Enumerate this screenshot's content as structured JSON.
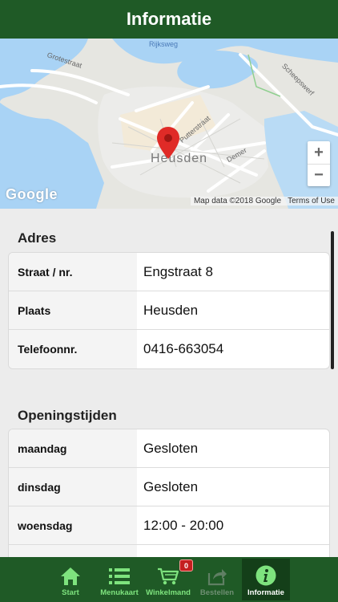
{
  "header": {
    "title": "Informatie"
  },
  "map": {
    "town_label": "Heusden",
    "street_labels": [
      "Grotestraat",
      "Putterstraat",
      "Demer",
      "Scheepswerf",
      "Rijksweg"
    ],
    "google_logo": "Google",
    "attribution": "Map data ©2018 Google",
    "terms": "Terms of Use",
    "zoom_in": "+",
    "zoom_out": "−"
  },
  "address": {
    "title": "Adres",
    "rows": [
      {
        "label": "Straat / nr.",
        "value": "Engstraat 8"
      },
      {
        "label": "Plaats",
        "value": "Heusden"
      },
      {
        "label": "Telefoonnr.",
        "value": "0416-663054"
      }
    ]
  },
  "hours": {
    "title": "Openingstijden",
    "rows": [
      {
        "label": "maandag",
        "value": "Gesloten"
      },
      {
        "label": "dinsdag",
        "value": "Gesloten"
      },
      {
        "label": "woensdag",
        "value": "12:00 - 20:00"
      }
    ]
  },
  "tabbar": {
    "tabs": [
      {
        "label": "Start",
        "icon": "home-icon"
      },
      {
        "label": "Menukaart",
        "icon": "list-icon"
      },
      {
        "label": "Winkelmand",
        "icon": "cart-icon",
        "badge": "0"
      },
      {
        "label": "Bestellen",
        "icon": "share-icon",
        "disabled": true
      },
      {
        "label": "Informatie",
        "icon": "info-icon",
        "active": true
      }
    ]
  },
  "colors": {
    "brand_green": "#1f5a26",
    "tab_text": "#7ee37e",
    "badge_red": "#c41f1f"
  }
}
